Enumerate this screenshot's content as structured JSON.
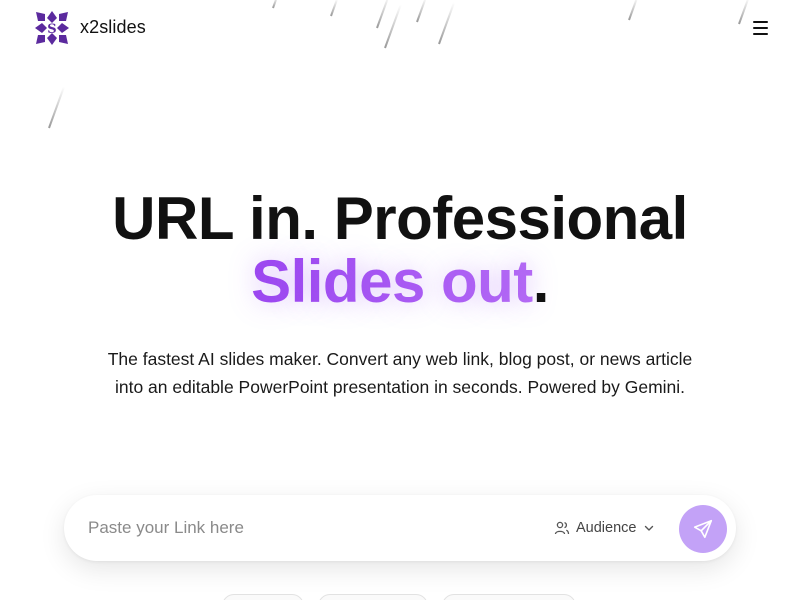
{
  "brand": {
    "name": "x2slides",
    "logo_letter": "S"
  },
  "header": {
    "menu_icon": "hamburger-menu-icon"
  },
  "hero": {
    "title_line1": "URL in. Professional",
    "title_accent": "Slides out",
    "title_period": ".",
    "subtitle_line1": "The fastest AI slides maker. Convert any web link, blog post, or news article",
    "subtitle_line2": "into an editable PowerPoint presentation in seconds. Powered by Gemini."
  },
  "input_bar": {
    "placeholder": "Paste your Link here",
    "value": "",
    "audience_label": "Audience",
    "audience_icon": "users-icon",
    "dropdown_icon": "chevron-down-icon",
    "send_icon": "send-icon"
  },
  "colors": {
    "accent": "#9c46f0",
    "send_button": "#c3a2f7",
    "logo": "#5b2a9e",
    "text": "#111111"
  }
}
